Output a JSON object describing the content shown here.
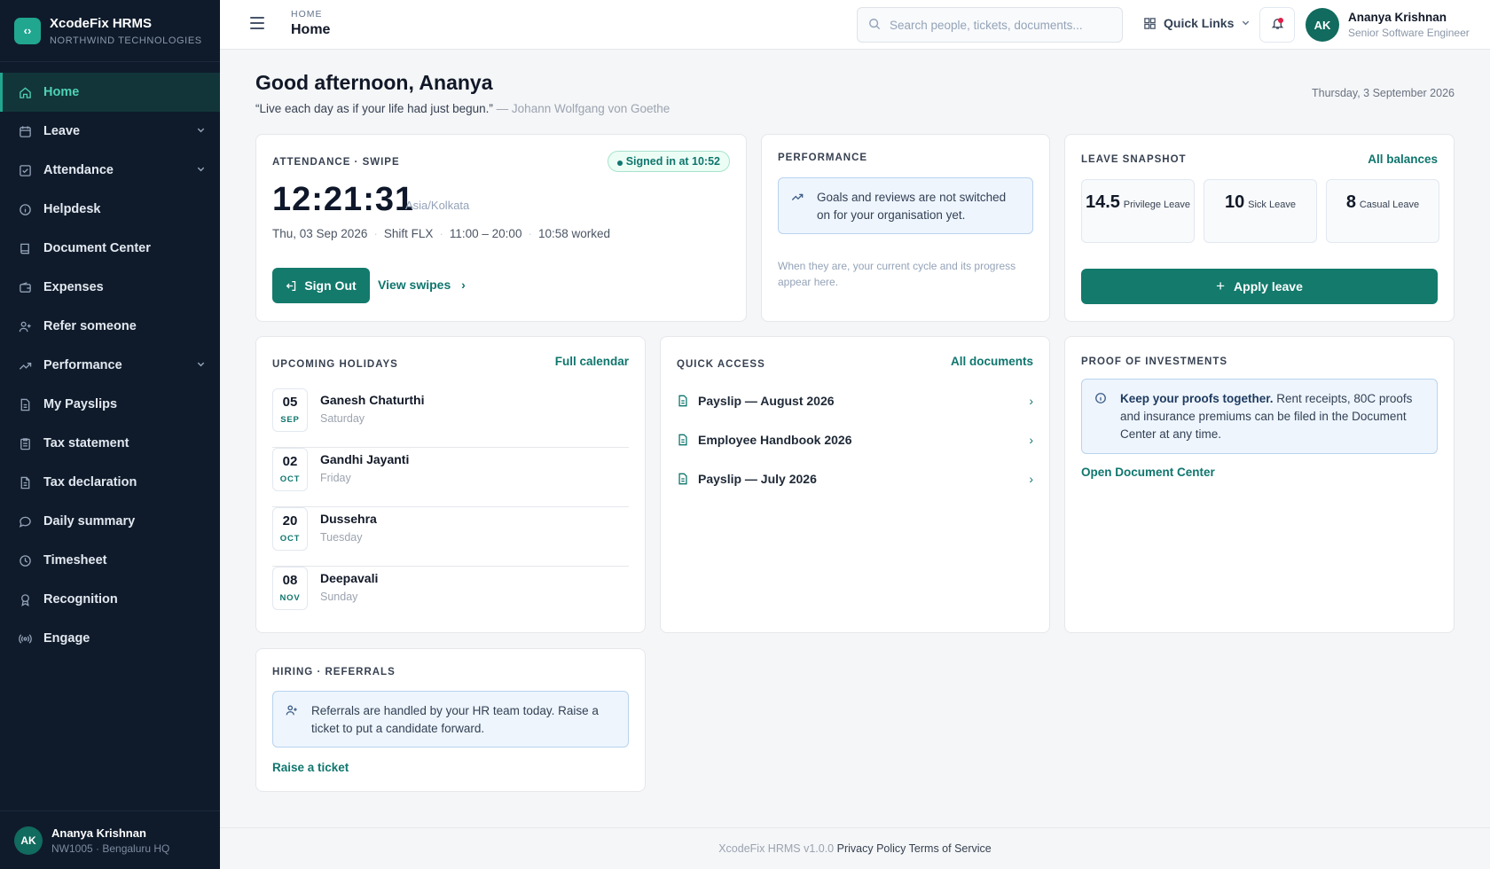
{
  "brand": {
    "name": "XcodeFix HRMS",
    "org": "NORTHWIND TECHNOLOGIES",
    "logo_icon": "code-brackets-icon"
  },
  "sidebar": {
    "items": [
      {
        "label": "Home",
        "icon": "home-icon",
        "active": true
      },
      {
        "label": "Leave",
        "icon": "calendar-icon",
        "expandable": true
      },
      {
        "label": "Attendance",
        "icon": "check-square-icon",
        "expandable": true
      },
      {
        "label": "Helpdesk",
        "icon": "info-circle-icon"
      },
      {
        "label": "Document Center",
        "icon": "book-icon"
      },
      {
        "label": "Expenses",
        "icon": "wallet-icon"
      },
      {
        "label": "Refer someone",
        "icon": "user-plus-icon"
      },
      {
        "label": "Performance",
        "icon": "trend-icon",
        "expandable": true
      },
      {
        "label": "My Payslips",
        "icon": "file-icon"
      },
      {
        "label": "Tax statement",
        "icon": "clipboard-icon"
      },
      {
        "label": "Tax declaration",
        "icon": "file-text-icon"
      },
      {
        "label": "Daily summary",
        "icon": "chat-icon"
      },
      {
        "label": "Timesheet",
        "icon": "clock-icon"
      },
      {
        "label": "Recognition",
        "icon": "award-icon"
      },
      {
        "label": "Engage",
        "icon": "broadcast-icon"
      }
    ],
    "user": {
      "initials": "AK",
      "name": "Ananya Krishnan",
      "sub": "NW1005 · Bengaluru HQ"
    }
  },
  "topbar": {
    "crumb": "HOME",
    "title": "Home",
    "search_placeholder": "Search people, tickets, documents...",
    "quick_links": "Quick Links",
    "user": {
      "initials": "AK",
      "name": "Ananya Krishnan",
      "role": "Senior Software Engineer"
    }
  },
  "greeting": {
    "title": "Good afternoon, Ananya",
    "quote": "“Live each day as if your life had just begun.”",
    "author": "— Johann Wolfgang von Goethe",
    "date": "Thursday, 3 September 2026"
  },
  "attendance": {
    "title": "ATTENDANCE · SWIPE",
    "status": "Signed in at 10:52",
    "time": "12:21:31",
    "timezone": "Asia/Kolkata",
    "date": "Thu, 03 Sep 2026",
    "shift": "Shift FLX",
    "hours": "11:00 – 20:00",
    "worked": "10:58 worked",
    "sign_out": "Sign Out",
    "view_swipes": "View swipes"
  },
  "performance": {
    "title": "PERFORMANCE",
    "notice": "Goals and reviews are not switched on for your organisation yet.",
    "note": "When they are, your current cycle and its progress appear here."
  },
  "leave": {
    "title": "LEAVE SNAPSHOT",
    "link": "All balances",
    "balances": [
      {
        "num": "14.5",
        "label": "Privilege Leave"
      },
      {
        "num": "10",
        "label": "Sick Leave"
      },
      {
        "num": "8",
        "label": "Casual Leave"
      }
    ],
    "apply": "Apply leave"
  },
  "holidays": {
    "title": "UPCOMING HOLIDAYS",
    "link": "Full calendar",
    "items": [
      {
        "day": "05",
        "month": "SEP",
        "name": "Ganesh Chaturthi",
        "weekday": "Saturday"
      },
      {
        "day": "02",
        "month": "OCT",
        "name": "Gandhi Jayanti",
        "weekday": "Friday"
      },
      {
        "day": "20",
        "month": "OCT",
        "name": "Dussehra",
        "weekday": "Tuesday"
      },
      {
        "day": "08",
        "month": "NOV",
        "name": "Deepavali",
        "weekday": "Sunday"
      }
    ]
  },
  "quick_access": {
    "title": "QUICK ACCESS",
    "link": "All documents",
    "items": [
      {
        "label": "Payslip — August 2026"
      },
      {
        "label": "Employee Handbook 2026"
      },
      {
        "label": "Payslip — July 2026"
      }
    ]
  },
  "investments": {
    "title": "PROOF OF INVESTMENTS",
    "bold": "Keep your proofs together.",
    "text": " Rent receipts, 80C proofs and insurance premiums can be filed in the Document Center at any time.",
    "link": "Open Document Center"
  },
  "referrals": {
    "title": "HIRING · REFERRALS",
    "notice": "Referrals are handled by your HR team today. Raise a ticket to put a candidate forward.",
    "link": "Raise a ticket"
  },
  "footer": {
    "version": "XcodeFix HRMS v1.0.0",
    "privacy": "Privacy Policy",
    "terms": "Terms of Service"
  },
  "colors": {
    "accent": "#137a6c",
    "sidebar": "#0f1b2b",
    "info_bg": "#eef5fd"
  }
}
